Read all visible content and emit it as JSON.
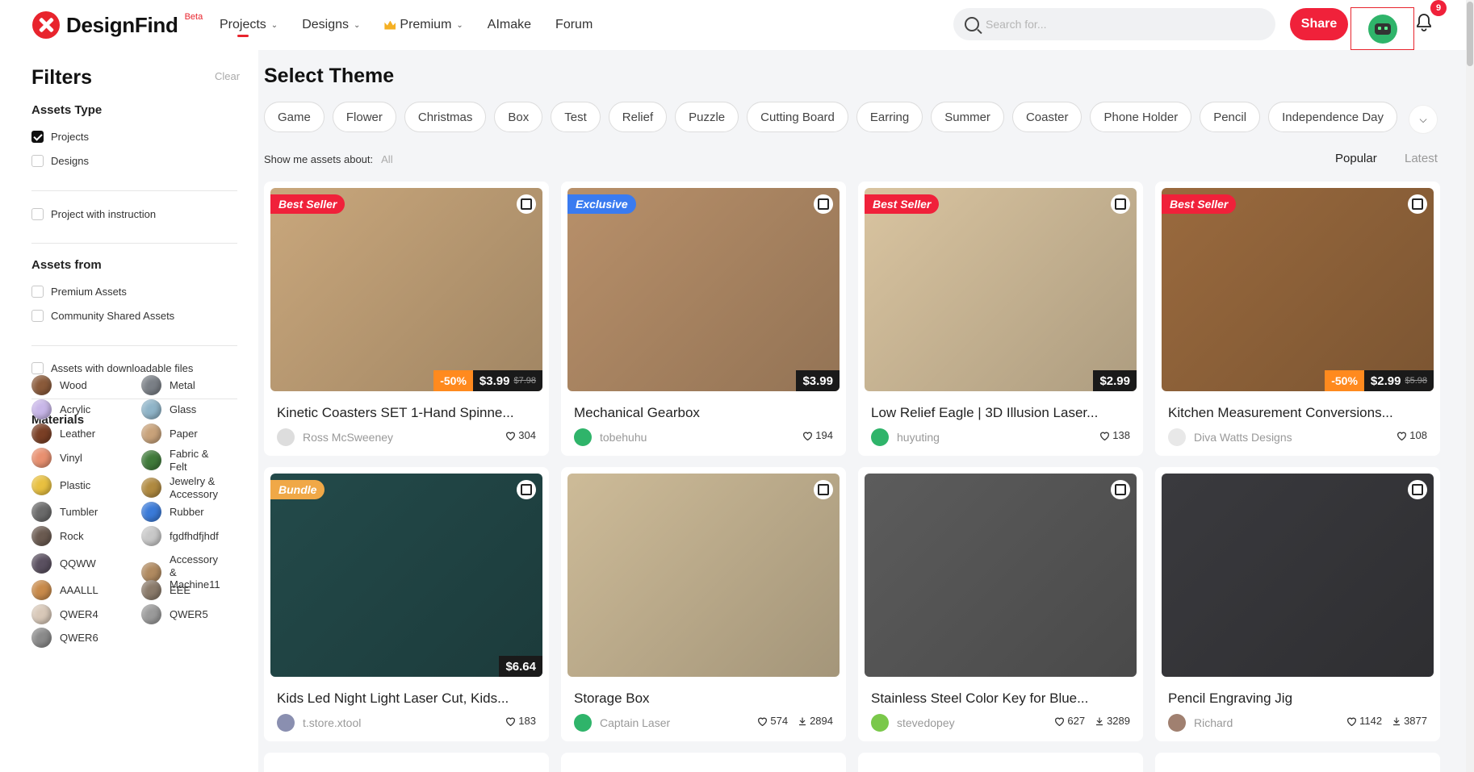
{
  "header": {
    "logo_text": "DesignFind",
    "beta": "Beta",
    "nav": [
      {
        "label": "Projects",
        "chevron": true
      },
      {
        "label": "Designs",
        "chevron": true
      },
      {
        "label": "Premium",
        "chevron": true
      },
      {
        "label": "AImake",
        "chevron": false
      },
      {
        "label": "Forum",
        "chevron": false
      }
    ],
    "search_placeholder": "Search for...",
    "share_label": "Share",
    "notification_count": "9",
    "accent_color": "#f0213a"
  },
  "sidebar": {
    "title": "Filters",
    "clear": "Clear",
    "assets_type_heading": "Assets Type",
    "assets_type": [
      {
        "label": "Projects",
        "checked": true
      },
      {
        "label": "Designs",
        "checked": false
      }
    ],
    "instruction": "Project with instruction",
    "assets_from_heading": "Assets from",
    "assets_from": [
      "Premium Assets",
      "Community Shared Assets"
    ],
    "downloadable": "Assets with downloadable files",
    "materials_heading": "Materials",
    "materials": [
      {
        "label": "Wood",
        "color": "#8a5a3a"
      },
      {
        "label": "Metal",
        "color": "#7a7f86"
      },
      {
        "label": "Acrylic",
        "color": "#c8b6e8"
      },
      {
        "label": "Glass",
        "color": "#8fb4c8"
      },
      {
        "label": "Leather",
        "color": "#7a3f25"
      },
      {
        "label": "Paper",
        "color": "#c8a27a"
      },
      {
        "label": "Vinyl",
        "color": "#e89070"
      },
      {
        "label": "Fabric & Felt",
        "color": "#3f7a3a"
      },
      {
        "label": "Plastic",
        "color": "#e8c040"
      },
      {
        "label": "Jewelry & Accessory",
        "color": "#b08a40"
      },
      {
        "label": "Tumbler",
        "color": "#6a6a6a"
      },
      {
        "label": "Rubber",
        "color": "#3a7ad8"
      },
      {
        "label": "Rock",
        "color": "#6a5a50"
      },
      {
        "label": "fgdfhdfjhdf",
        "color": "#c8c8c8"
      },
      {
        "label": "QQWW",
        "color": "#5a5060"
      },
      {
        "label": "Accessory & Machine11",
        "color": "#b08a60"
      },
      {
        "label": "AAALLL",
        "color": "#c88a4a"
      },
      {
        "label": "EEE",
        "color": "#8a7a6a"
      },
      {
        "label": "QWER4",
        "color": "#d8c8b8"
      },
      {
        "label": "QWER5",
        "color": "#9a9a9a"
      },
      {
        "label": "QWER6",
        "color": "#8a8a8a"
      }
    ]
  },
  "main": {
    "title": "Select Theme",
    "themes": [
      "Game",
      "Flower",
      "Christmas",
      "Box",
      "Test",
      "Relief",
      "Puzzle",
      "Cutting Board",
      "Earring",
      "Summer",
      "Coaster",
      "Phone Holder",
      "Pencil",
      "Independence Day"
    ],
    "show_me_label": "Show me assets about:",
    "show_me_value": "All",
    "sort_popular": "Popular",
    "sort_latest": "Latest"
  },
  "cards": [
    {
      "title": "Kinetic Coasters SET 1-Hand Spinne...",
      "badge": "Best Seller",
      "badge_color": "red",
      "discount": "-50%",
      "price": "$3.99",
      "old_price": "$7.98",
      "author": "Ross McSweeney",
      "likes": "304",
      "downloads": "",
      "img": "#c9a77c",
      "av": "#dddddd"
    },
    {
      "title": "Mechanical Gearbox",
      "badge": "Exclusive",
      "badge_color": "blue",
      "discount": "",
      "price": "$3.99",
      "old_price": "",
      "author": "tobehuhu",
      "likes": "194",
      "downloads": "",
      "img": "#b8906a",
      "av": "#2fb46a"
    },
    {
      "title": "Low Relief Eagle | 3D Illusion Laser...",
      "badge": "Best Seller",
      "badge_color": "red",
      "discount": "",
      "price": "$2.99",
      "old_price": "",
      "author": "huyuting",
      "likes": "138",
      "downloads": "",
      "img": "#d9c4a0",
      "av": "#2fb46a"
    },
    {
      "title": "Kitchen Measurement Conversions...",
      "badge": "Best Seller",
      "badge_color": "red",
      "discount": "-50%",
      "price": "$2.99",
      "old_price": "$5.98",
      "author": "Diva Watts Designs",
      "likes": "108",
      "downloads": "",
      "img": "#9a6a3e",
      "av": "#e8e8e8"
    },
    {
      "title": "Kids Led Night Light Laser Cut, Kids...",
      "badge": "Bundle",
      "badge_color": "gold",
      "discount": "",
      "price": "$6.64",
      "old_price": "",
      "author": "t.store.xtool",
      "likes": "183",
      "downloads": "",
      "img": "#234a4a",
      "av": "#8a8fb0"
    },
    {
      "title": "Storage Box",
      "badge": "",
      "badge_color": "",
      "discount": "",
      "price": "",
      "old_price": "",
      "author": "Captain Laser",
      "likes": "574",
      "downloads": "2894",
      "img": "#cdbb98",
      "av": "#2fb46a"
    },
    {
      "title": "Stainless Steel Color Key for Blue...",
      "badge": "",
      "badge_color": "",
      "discount": "",
      "price": "",
      "old_price": "",
      "author": "stevedopey",
      "likes": "627",
      "downloads": "3289",
      "img": "#5c5c5c",
      "av": "#7ac84a"
    },
    {
      "title": "Pencil Engraving Jig",
      "badge": "",
      "badge_color": "",
      "discount": "",
      "price": "",
      "old_price": "",
      "author": "Richard",
      "likes": "1142",
      "downloads": "3877",
      "img": "#3a3a3e",
      "av": "#a08070"
    }
  ]
}
